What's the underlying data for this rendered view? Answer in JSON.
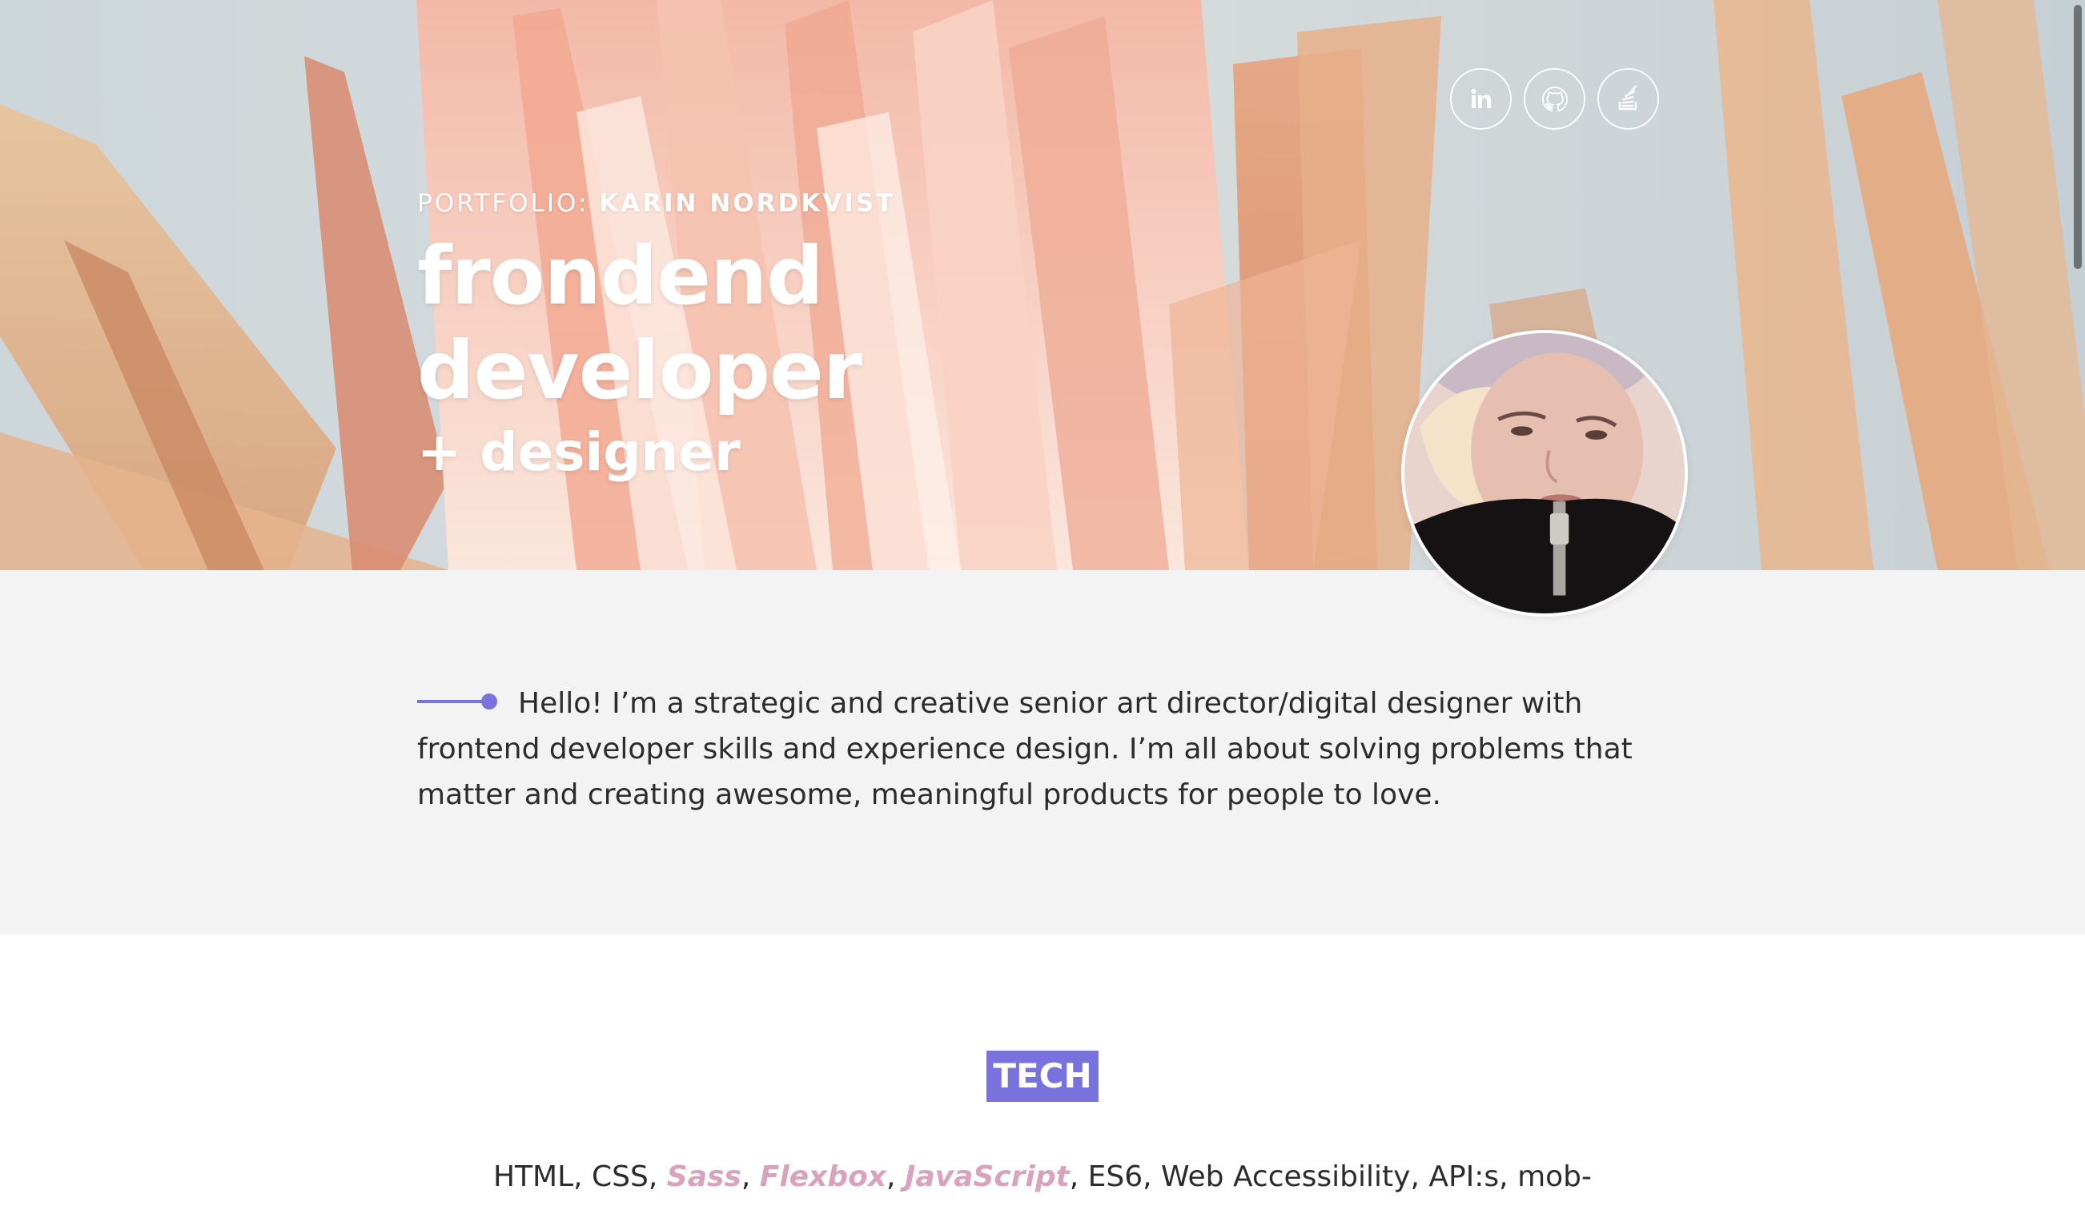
{
  "hero": {
    "kicker_prefix": "PORTFOLIO:",
    "kicker_name": "KARIN NORDKVIST",
    "title_line1": "frondend",
    "title_line2": "developer",
    "subtitle": "+ designer"
  },
  "social": [
    {
      "name": "LinkedIn",
      "icon": "linkedin-icon"
    },
    {
      "name": "GitHub",
      "icon": "github-icon"
    },
    {
      "name": "Stack Overflow",
      "icon": "stackoverflow-icon"
    }
  ],
  "intro": {
    "text": "Hello! I’m a strategic and creative senior art director/digital designer with frontend developer skills and experience design. I’m all about solving problems that matter and creating awesome, meaningful products for people to love."
  },
  "tech": {
    "heading": "TECH",
    "items": {
      "html_css": "HTML, CSS, ",
      "sass": "Sass",
      "sep1": ", ",
      "flexbox": "Flexbox",
      "sep2": ", ",
      "javascript": "JavaScript",
      "rest": ", ES6, Web Accessibility, API:s, mob-"
    }
  },
  "colors": {
    "accent": "#7a72dc",
    "highlight": "#d9a3bd",
    "intro_bg": "#f3f3f3",
    "text": "#2c2c2c"
  }
}
